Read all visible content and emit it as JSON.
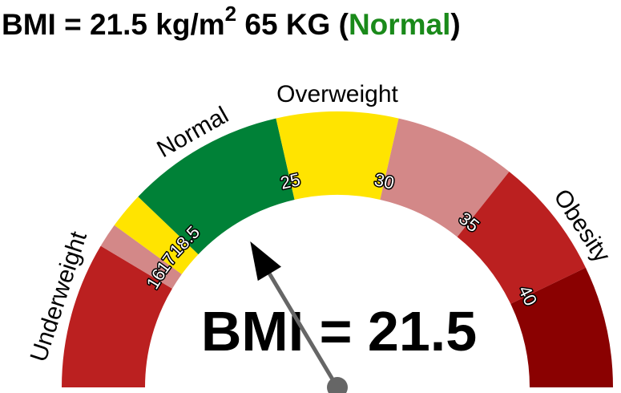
{
  "header": {
    "bmi_text": "BMI = 21.5 kg/m",
    "unit_exponent": "2",
    "weight_text": "65 KG",
    "open_paren": "(",
    "status": "Normal",
    "close_paren": ")",
    "status_color": "#1a8a1a"
  },
  "chart_data": {
    "type": "gauge",
    "range": [
      10,
      45
    ],
    "bands": [
      {
        "from": 10,
        "to": 16,
        "color": "#bb2020"
      },
      {
        "from": 16,
        "to": 17,
        "color": "#d38888"
      },
      {
        "from": 17,
        "to": 18.5,
        "color": "#ffe400"
      },
      {
        "from": 18.5,
        "to": 25,
        "color": "#008137"
      },
      {
        "from": 25,
        "to": 30,
        "color": "#ffe400"
      },
      {
        "from": 30,
        "to": 35,
        "color": "#d38888"
      },
      {
        "from": 35,
        "to": 40,
        "color": "#bb2020"
      },
      {
        "from": 40,
        "to": 45,
        "color": "#8a0101"
      }
    ],
    "tick_labels": [
      {
        "value": 16,
        "label": "16"
      },
      {
        "value": 17,
        "label": "17"
      },
      {
        "value": 18.5,
        "label": "18.5"
      },
      {
        "value": 25,
        "label": "25"
      },
      {
        "value": 30,
        "label": "30"
      },
      {
        "value": 35,
        "label": "35"
      },
      {
        "value": 40,
        "label": "40"
      }
    ],
    "category_labels": [
      {
        "label": "Underweight",
        "value": 13.5
      },
      {
        "label": "Normal",
        "value": 21.75
      },
      {
        "label": "Overweight",
        "value": 27.5
      },
      {
        "label": "Obesity",
        "value": 38.5
      }
    ],
    "needle_value": 21.5,
    "needle_color": "#666666",
    "big_label": "BMI = 21.5"
  }
}
